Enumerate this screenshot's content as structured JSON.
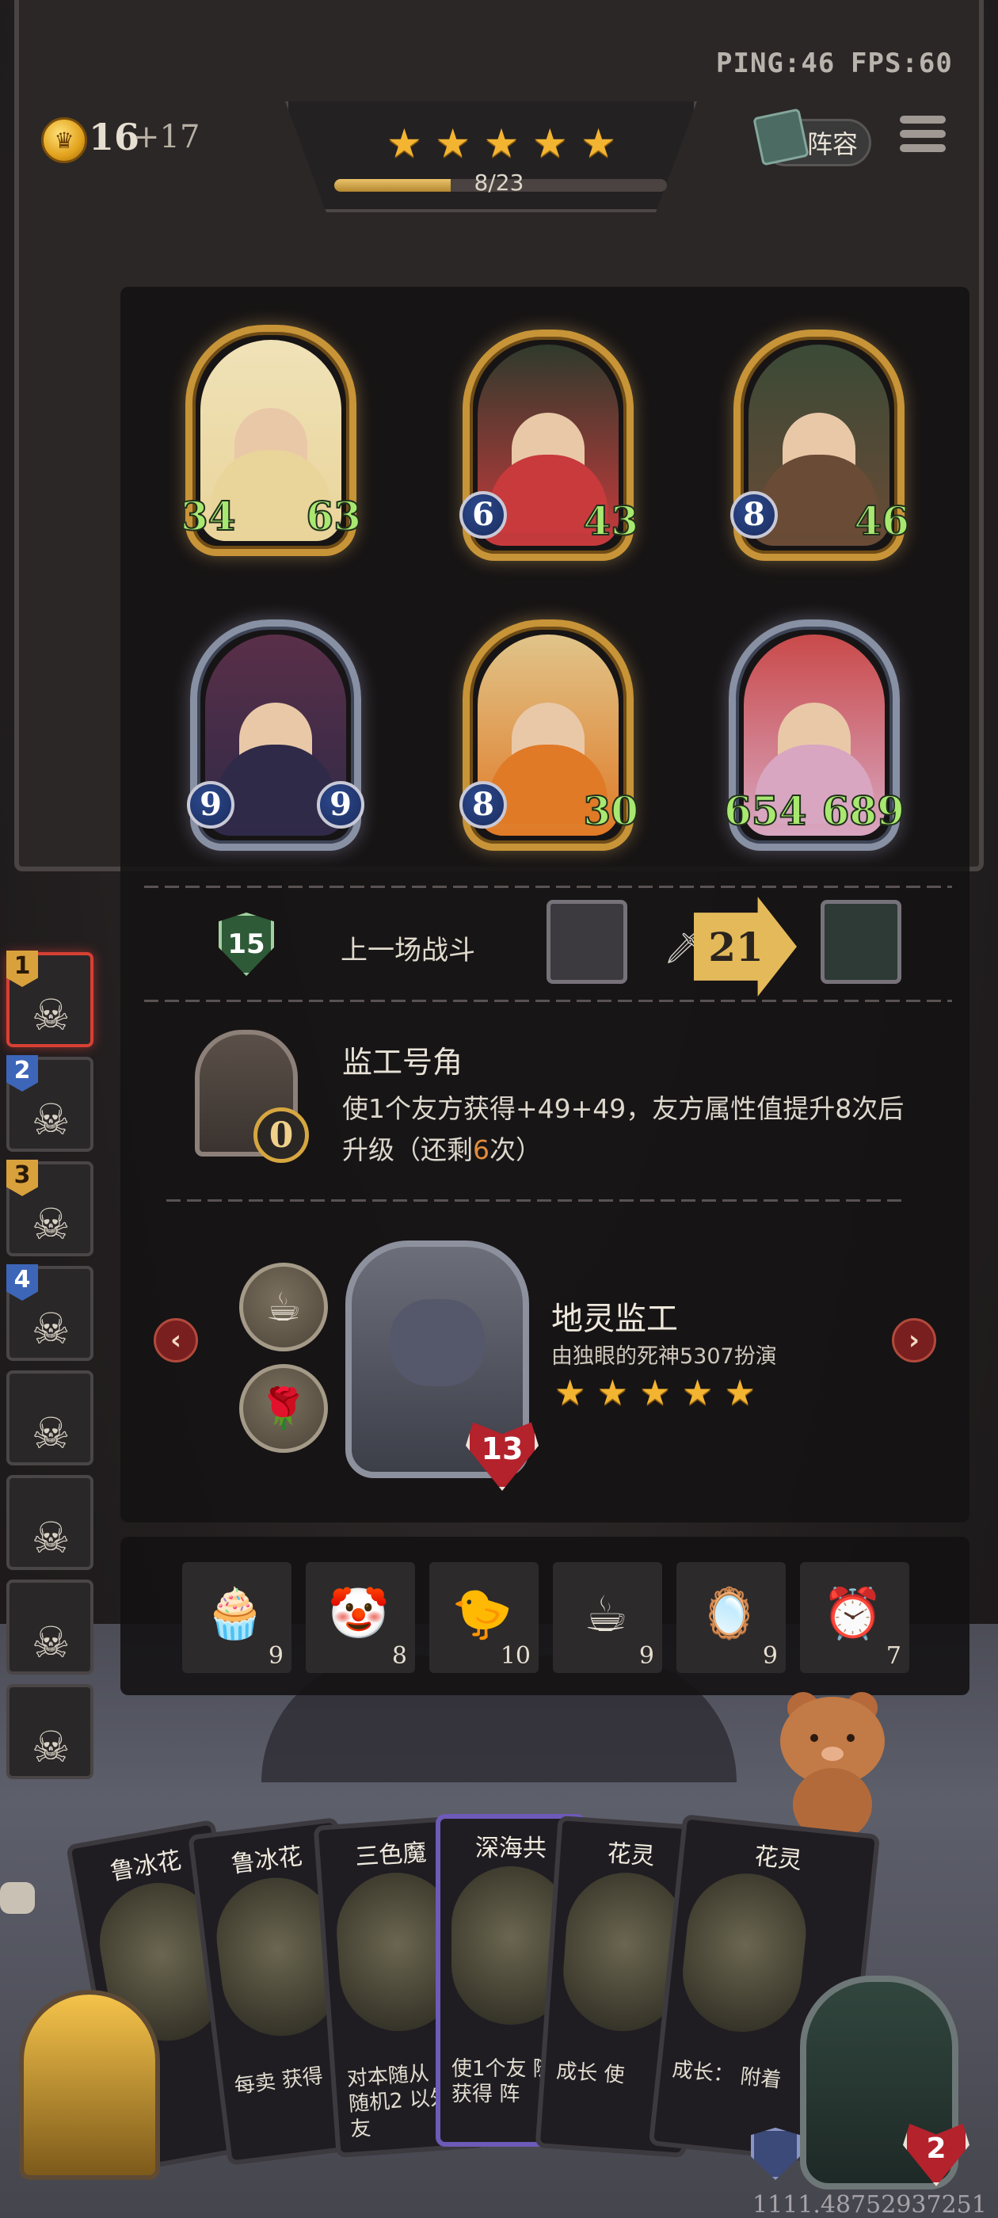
{
  "hud": {
    "ping_label": "PING:46",
    "fps_label": "FPS:60",
    "gold": "16",
    "gold_income": "+17",
    "stars": 5,
    "level_progress": "8/23",
    "level_fraction": 0.35,
    "lineup_label": "阵容",
    "menu_icon": "hamburger-menu-icon"
  },
  "board": {
    "units": [
      {
        "name": "",
        "atk": "34",
        "hp": "63",
        "frame": "gold",
        "colors": [
          "#f0e2b8",
          "#e9d49a"
        ],
        "atk_style": "text"
      },
      {
        "name": "",
        "atk": "6",
        "hp": "43",
        "frame": "gold",
        "colors": [
          "#2f3a2c",
          "#c83a3c"
        ],
        "atk_style": "circle"
      },
      {
        "name": "",
        "atk": "8",
        "hp": "46",
        "frame": "gold",
        "colors": [
          "#3a4a36",
          "#6a4b36"
        ],
        "atk_style": "circle"
      },
      {
        "name": "",
        "atk": "9",
        "hp": "9",
        "frame": "silver",
        "colors": [
          "#5a2f48",
          "#2f2a48"
        ],
        "atk_style": "circle",
        "hp_style": "circle"
      },
      {
        "name": "",
        "atk": "8",
        "hp": "30",
        "frame": "gold",
        "colors": [
          "#e0c48a",
          "#e07a26"
        ],
        "atk_style": "circle"
      },
      {
        "name": "",
        "atk": "654",
        "hp": "689",
        "frame": "silver",
        "colors": [
          "#c94a4a",
          "#d8a6c0"
        ],
        "atk_style": "text"
      }
    ]
  },
  "last_battle": {
    "shield_value": "15",
    "label": "上一场战斗",
    "damage": "21"
  },
  "item": {
    "name": "监工号角",
    "count": "0",
    "desc_before": "使1个友方获得+49+49，友方属性值提升8次后升级（还剩",
    "desc_highlight": "6",
    "desc_after": "次）"
  },
  "hero": {
    "name": "地灵监工",
    "subtitle": "由独眼的死神5307扮演",
    "stars": 5,
    "hp": "13",
    "relic_icons": [
      "teacup-icon",
      "rose-bush-icon"
    ]
  },
  "inventory": [
    {
      "icon": "cupcake-icon",
      "glyph": "🧁",
      "count": "9"
    },
    {
      "icon": "clown-icon",
      "glyph": "🤡",
      "count": "8"
    },
    {
      "icon": "rubber-chicken-icon",
      "glyph": "🐤",
      "count": "10"
    },
    {
      "icon": "teacup-icon",
      "glyph": "☕",
      "count": "9"
    },
    {
      "icon": "mirror-icon",
      "glyph": "🪞",
      "count": "9"
    },
    {
      "icon": "alarm-clock-icon",
      "glyph": "⏰",
      "count": "7"
    }
  ],
  "roster": [
    {
      "rank": "1",
      "rank_color": "gold",
      "active": true
    },
    {
      "rank": "2",
      "rank_color": "blue",
      "active": false
    },
    {
      "rank": "3",
      "rank_color": "gold",
      "active": false
    },
    {
      "rank": "4",
      "rank_color": "blue",
      "active": false
    },
    {
      "rank": "",
      "active": false
    },
    {
      "rank": "",
      "active": false
    },
    {
      "rank": "",
      "active": false
    },
    {
      "rank": "",
      "active": false
    }
  ],
  "hand": [
    {
      "title": "鲁冰花",
      "text": ""
    },
    {
      "title": "鲁冰花",
      "text": "每卖 获得"
    },
    {
      "title": "三色魔",
      "text": "对本随从 对随机2 以外的友"
    },
    {
      "title": "深海共",
      "text": "使1个友 随机获得 阵"
    },
    {
      "title": "花灵",
      "text": "成长 使"
    },
    {
      "title": "花灵",
      "text": "成长： 附着"
    }
  ],
  "opponent": {
    "hp": "2"
  },
  "coords": "1111.48752937251"
}
